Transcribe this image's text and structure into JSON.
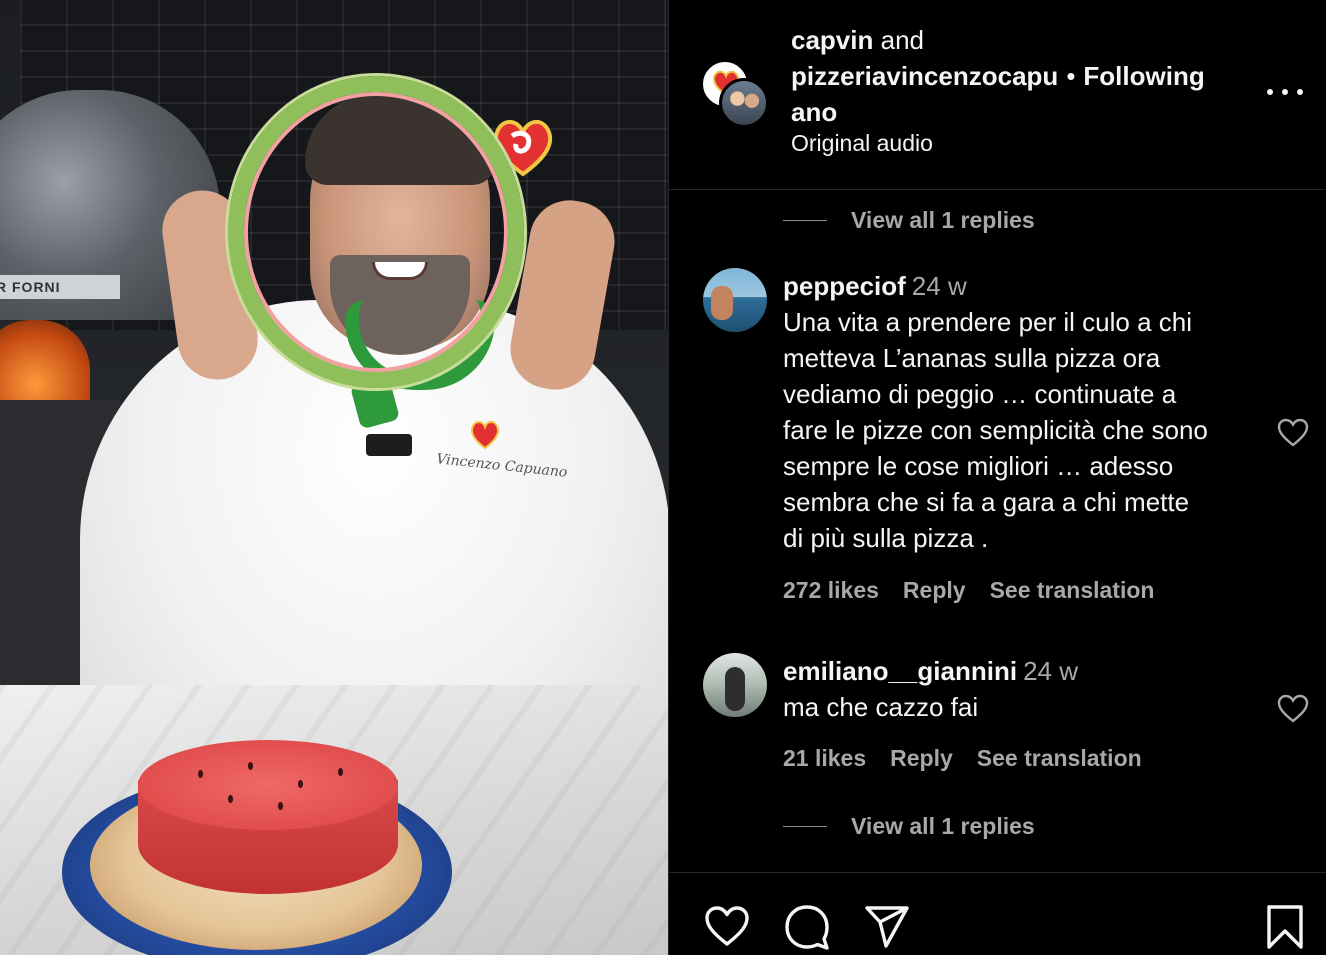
{
  "post": {
    "author_primary": "capvin",
    "author_joiner": "and",
    "author_secondary_line1": "pizzeriavincenzocapu",
    "author_secondary_line2": "ano",
    "separator": "•",
    "follow_status": "Following",
    "audio": "Original audio",
    "more_icon": "more-horizontal-icon"
  },
  "media": {
    "oven_brand": "R FORNI",
    "chef_embroidery": "Vincenzo Capuano"
  },
  "comments": {
    "top_replies_toggle": "View all 1 replies",
    "items": [
      {
        "username": "peppeciof",
        "time": "24 w",
        "text_lines": [
          "Una vita a prendere per il culo a chi",
          "metteva L’ananas sulla pizza ora",
          "vediamo di peggio … continuate a",
          "fare le pizze con semplicità che sono",
          "sempre le cose migliori … adesso",
          "sembra che si fa a gara a chi mette",
          "di più sulla pizza ."
        ],
        "likes": "272 likes",
        "reply": "Reply",
        "translate": "See translation"
      },
      {
        "username": "emiliano__giannini",
        "time": "24 w",
        "text_lines": [
          "ma che cazzo fai"
        ],
        "likes": "21 likes",
        "reply": "Reply",
        "translate": "See translation",
        "replies_toggle": "View all 1 replies"
      }
    ]
  },
  "actions": {
    "like_icon": "heart-icon",
    "comment_icon": "comment-bubble-icon",
    "share_icon": "paper-plane-icon",
    "save_icon": "bookmark-icon"
  },
  "colors": {
    "background": "#000000",
    "text_primary": "#f5f5f5",
    "text_secondary": "#a8a8a8",
    "divider": "#262626"
  }
}
